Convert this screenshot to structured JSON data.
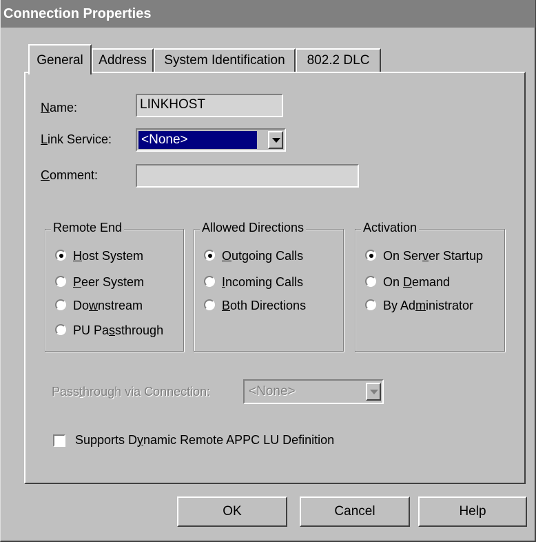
{
  "window": {
    "title": "Connection Properties"
  },
  "tabs": [
    {
      "label": "General",
      "active": true
    },
    {
      "label": "Address",
      "active": false
    },
    {
      "label": "System Identification",
      "active": false
    },
    {
      "label": "802.2 DLC",
      "active": false
    }
  ],
  "form": {
    "name": {
      "label_pre": "",
      "label_key": "N",
      "label_post": "ame:",
      "value": "LINKHOST"
    },
    "link_service": {
      "label_pre": "",
      "label_key": "L",
      "label_post": "ink Service:",
      "value": "<None>"
    },
    "comment": {
      "label_pre": "",
      "label_key": "C",
      "label_post": "omment:",
      "value": ""
    }
  },
  "remote_end": {
    "title": "Remote End",
    "options": [
      {
        "pre": "",
        "key": "H",
        "post": "ost System",
        "selected": true
      },
      {
        "pre": "",
        "key": "P",
        "post": "eer System",
        "selected": false
      },
      {
        "pre": "Do",
        "key": "w",
        "post": "nstream",
        "selected": false
      },
      {
        "pre": "PU Pa",
        "key": "s",
        "post": "sthrough",
        "selected": false
      }
    ]
  },
  "allowed_directions": {
    "title": "Allowed Directions",
    "options": [
      {
        "pre": "",
        "key": "O",
        "post": "utgoing Calls",
        "selected": true
      },
      {
        "pre": "",
        "key": "I",
        "post": "ncoming Calls",
        "selected": false
      },
      {
        "pre": "",
        "key": "B",
        "post": "oth Directions",
        "selected": false
      }
    ]
  },
  "activation": {
    "title": "Activation",
    "options": [
      {
        "pre": "On Ser",
        "key": "v",
        "post": "er Startup",
        "selected": true
      },
      {
        "pre": "On ",
        "key": "D",
        "post": "emand",
        "selected": false
      },
      {
        "pre": "By Ad",
        "key": "m",
        "post": "inistrator",
        "selected": false
      }
    ]
  },
  "passthrough": {
    "label_pre": "Pass",
    "label_key": "t",
    "label_post": "hrough via Connection:",
    "value": "<None>",
    "enabled": false
  },
  "dynamic_appc": {
    "label_pre": "Supports D",
    "label_key": "y",
    "label_post": "namic Remote APPC LU Definition",
    "checked": false
  },
  "buttons": {
    "ok": "OK",
    "cancel": "Cancel",
    "help": "Help"
  },
  "colors": {
    "face": "#c0c0c0",
    "title_bar": "#808080",
    "selection": "#000080",
    "disabled_text": "#808080"
  }
}
